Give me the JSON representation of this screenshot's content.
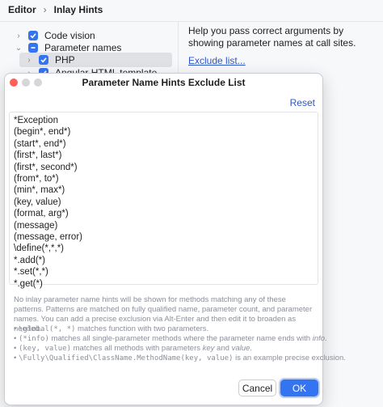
{
  "breadcrumb": {
    "root": "Editor",
    "current": "Inlay Hints"
  },
  "tree": {
    "items": [
      {
        "label": "Code vision",
        "expanded": false,
        "checked": true
      },
      {
        "label": "Parameter names",
        "expanded": true,
        "checked": "partial"
      },
      {
        "label": "PHP",
        "expanded": false,
        "checked": true,
        "selected": true
      },
      {
        "label": "Angular HTML template",
        "expanded": false,
        "checked": true
      }
    ]
  },
  "help": {
    "text": "Help you pass correct arguments by showing parameter names at call sites.",
    "exclude_link": "Exclude list..."
  },
  "dialog": {
    "title": "Parameter Name Hints Exclude List",
    "reset": "Reset",
    "patterns": [
      "*Exception",
      "(begin*, end*)",
      "(start*, end*)",
      "(first*, last*)",
      "(first*, second*)",
      "(from*, to*)",
      "(min*, max*)",
      "(key, value)",
      "(format, arg*)",
      "(message)",
      "(message, error)",
      "\\define(*,*,*)",
      "*.add(*)",
      "*.set(*,*)",
      "*.get(*)"
    ],
    "description": "No inlay parameter name hints will be shown for methods matching any of these patterns. Patterns are matched on fully qualified name, parameter count, and parameter names. You can add a precise exclusion via Alt-Enter and then edit it to broaden as needed.",
    "bullets": [
      {
        "code": "\\global(*, *)",
        "text": " matches function with two parameters."
      },
      {
        "code": "(*info)",
        "text": " matches all single-parameter methods where the parameter name ends with ",
        "em": "info",
        "tail": "."
      },
      {
        "code": "(key, value)",
        "text": " matches all methods with parameters ",
        "em": "key",
        "mid": " and ",
        "em2": "value",
        "tail": "."
      },
      {
        "code": "\\Fully\\Qualified\\ClassName.MethodName(key, value)",
        "text": " is an example precise exclusion."
      }
    ],
    "cancel_label": "Cancel",
    "ok_label": "OK"
  },
  "colors": {
    "accent": "#3574f0",
    "link": "#2e55c8",
    "close": "#ff5f57"
  }
}
